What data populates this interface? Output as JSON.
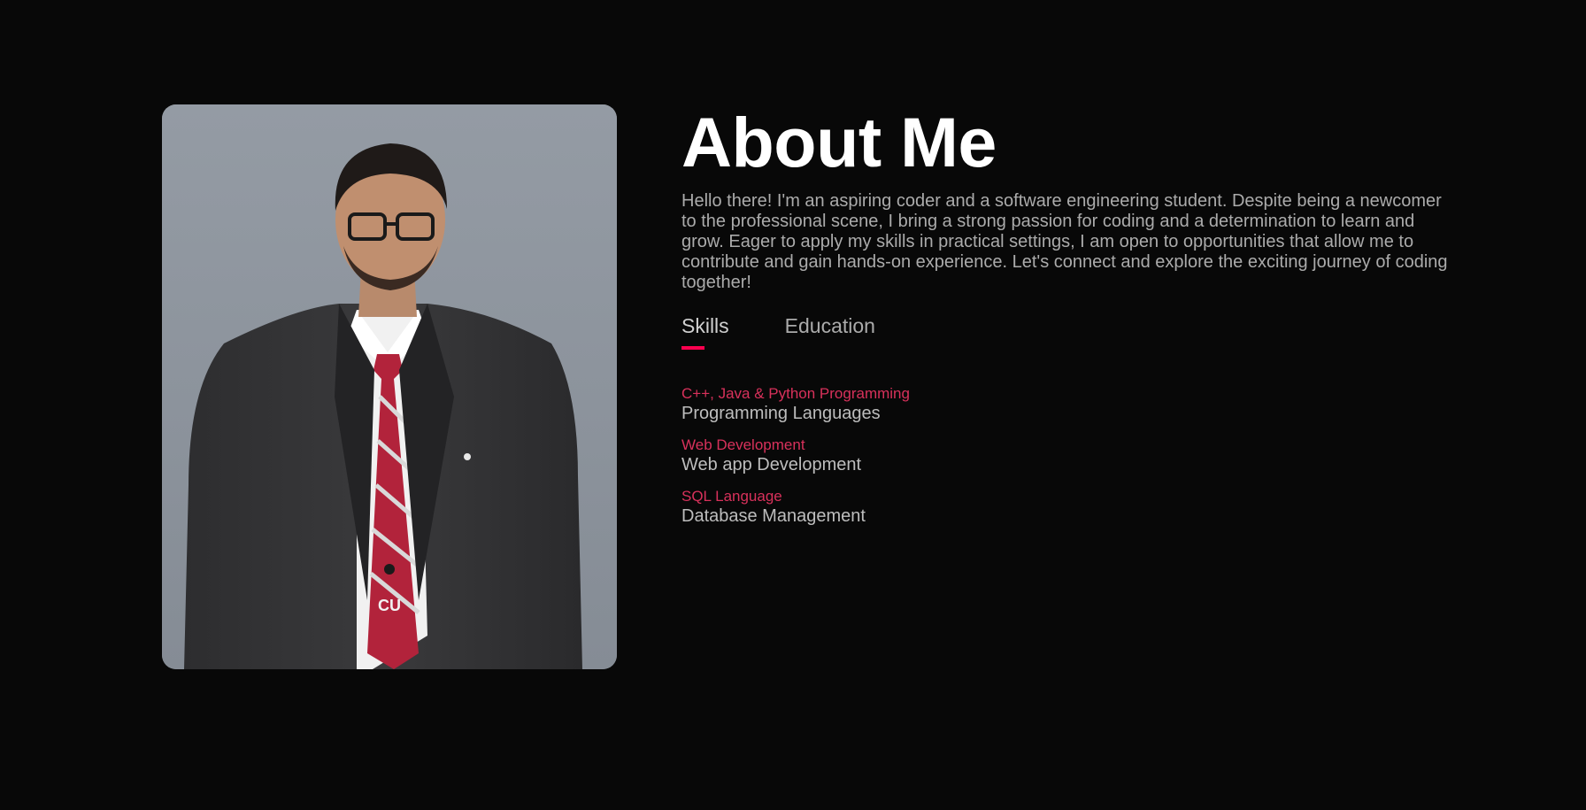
{
  "about": {
    "title": "About Me",
    "intro": "Hello there! I'm an aspiring coder and a software engineering student. Despite being a newcomer to the professional scene, I bring a strong passion for coding and a determination to learn and grow. Eager to apply my skills in practical settings, I am open to opportunities that allow me to contribute and gain hands-on experience. Let's connect and explore the exciting journey of coding together!",
    "photo_tie_text": "CU"
  },
  "tabs": [
    {
      "label": "Skills",
      "active": true
    },
    {
      "label": "Education",
      "active": false
    }
  ],
  "skills": [
    {
      "name": "C++, Java & Python Programming",
      "description": "Programming Languages"
    },
    {
      "name": "Web Development",
      "description": "Web app Development"
    },
    {
      "name": "SQL Language",
      "description": "Database Management"
    }
  ],
  "colors": {
    "background": "#080808",
    "accent": "#ff004f",
    "skill_name": "#d8315b",
    "body_text": "#ababab",
    "title": "#ffffff"
  }
}
